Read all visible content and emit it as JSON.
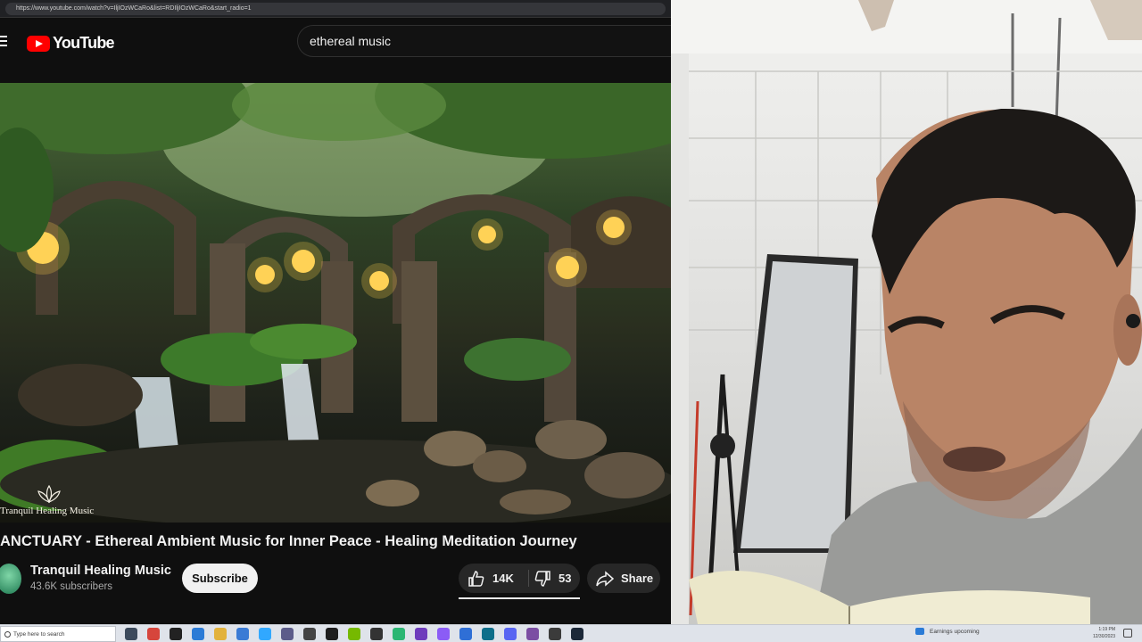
{
  "browser": {
    "url": "https://www.youtube.com/watch?v=IljIOzWCaRo&list=RDIljIOzWCaRo&start_radio=1"
  },
  "youtube": {
    "logo_text": "YouTube",
    "search_value": "ethereal music",
    "video_watermark": "Tranquil Healing Music",
    "video_title": "ANCTUARY - Ethereal Ambient Music for Inner Peace - Healing Meditation Journey",
    "channel_name": "Tranquil Healing Music",
    "subscribers": "43.6K subscribers",
    "subscribe_label": "Subscribe",
    "like_count": "14K",
    "dislike_count": "53",
    "share_label": "Share",
    "colors": {
      "brand": "#ff0000",
      "background": "#0f0f0f",
      "button": "#272727"
    }
  },
  "taskbar": {
    "search_placeholder": "Type here to search",
    "weather_text": "Earnings upcoming",
    "clock_time": "1:19 PM",
    "clock_date": "12/30/2023",
    "app_icons": [
      "task-view-icon",
      "chrome-icon",
      "obs-icon",
      "edge-icon",
      "file-explorer-icon",
      "mail-icon",
      "photoshop-icon",
      "app-icon",
      "game-icon",
      "terminal-icon",
      "nvidia-icon",
      "app-icon",
      "app-icon",
      "app-icon",
      "app-icon",
      "app-icon",
      "app-icon",
      "discord-icon",
      "app-icon",
      "app-icon",
      "steam-icon"
    ]
  }
}
